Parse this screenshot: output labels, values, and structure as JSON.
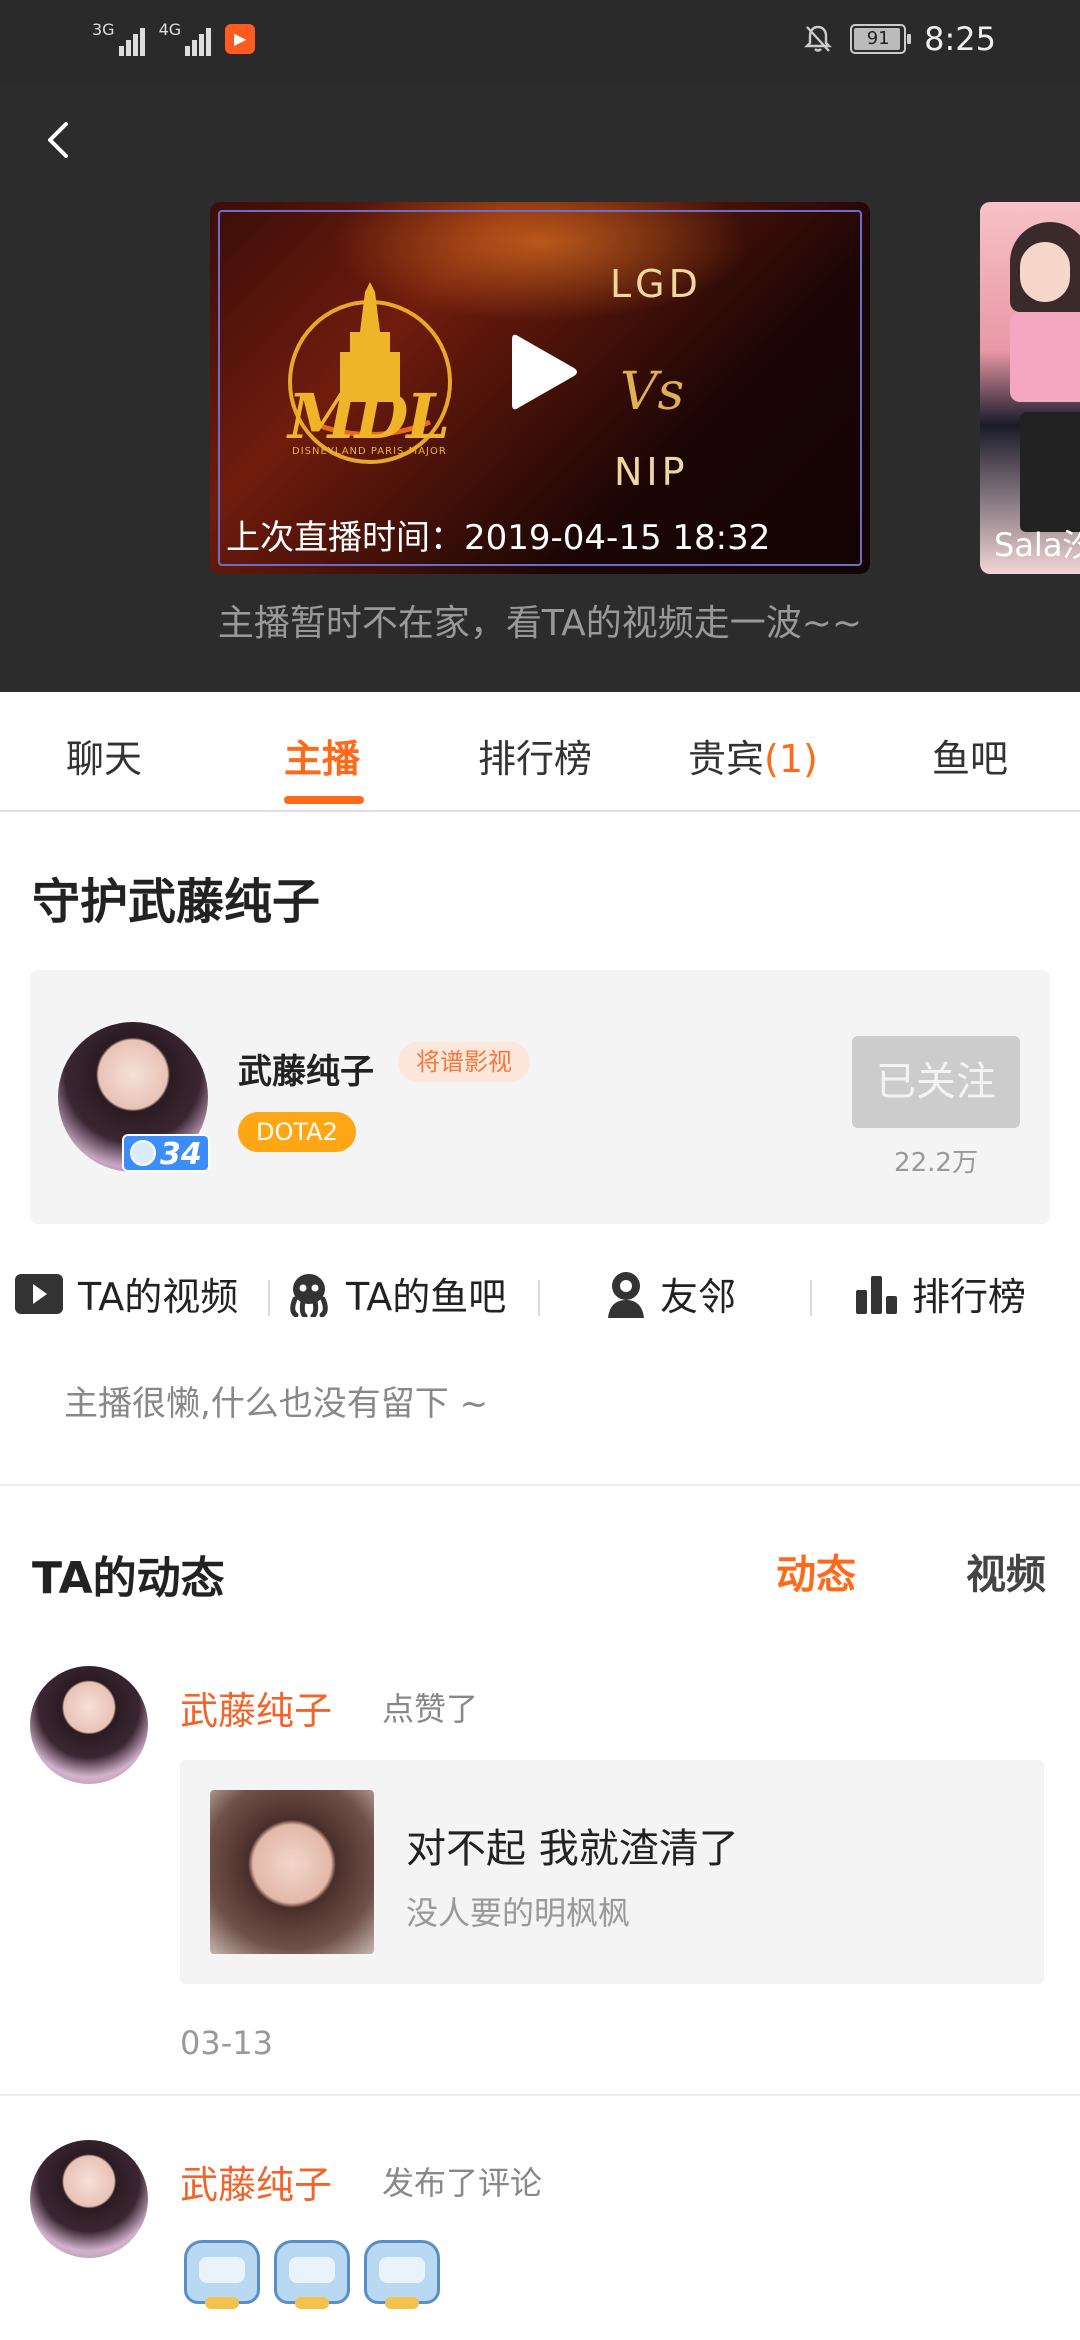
{
  "status_bar": {
    "net1": "3G",
    "net2": "4G",
    "app_icon": "play-icon",
    "battery": "91",
    "time": "8:25"
  },
  "hero": {
    "video": {
      "logo_text": "MDL",
      "logo_sub": "DISNEYLAND PARIS MAJOR",
      "team_top": "LGD",
      "vs": "Vs",
      "team_bottom": "NIP",
      "last_live": "上次直播时间：2019-04-15  18:32"
    },
    "side_thumb_name": "Sala汐",
    "offline_message": "主播暂时不在家，看TA的视频走一波~~"
  },
  "tabs": {
    "chat": "聊天",
    "anchor": "主播",
    "ranking": "排行榜",
    "vip": "贵宾",
    "vip_count": "(1)",
    "fishbar": "鱼吧"
  },
  "section_title": "守护武藤纯子",
  "anchor": {
    "name": "武藤纯子",
    "org": "将谱影视",
    "game": "DOTA2",
    "level": "34",
    "follow_label": "已关注",
    "followers": "22.2万"
  },
  "quick_links": {
    "videos": "TA的视频",
    "fishbar": "TA的鱼吧",
    "neighbors": "友邻",
    "ranking": "排行榜"
  },
  "bio": "主播很懒,什么也没有留下 ~",
  "feed": {
    "title": "TA的动态",
    "tab_dynamic": "动态",
    "tab_video": "视频",
    "items": [
      {
        "name": "武藤纯子",
        "action": "点赞了",
        "liked_title": "对不起 我就渣清了",
        "liked_author": "没人要的明枫枫",
        "date": "03-13"
      },
      {
        "name": "武藤纯子",
        "action": "发布了评论"
      }
    ]
  }
}
